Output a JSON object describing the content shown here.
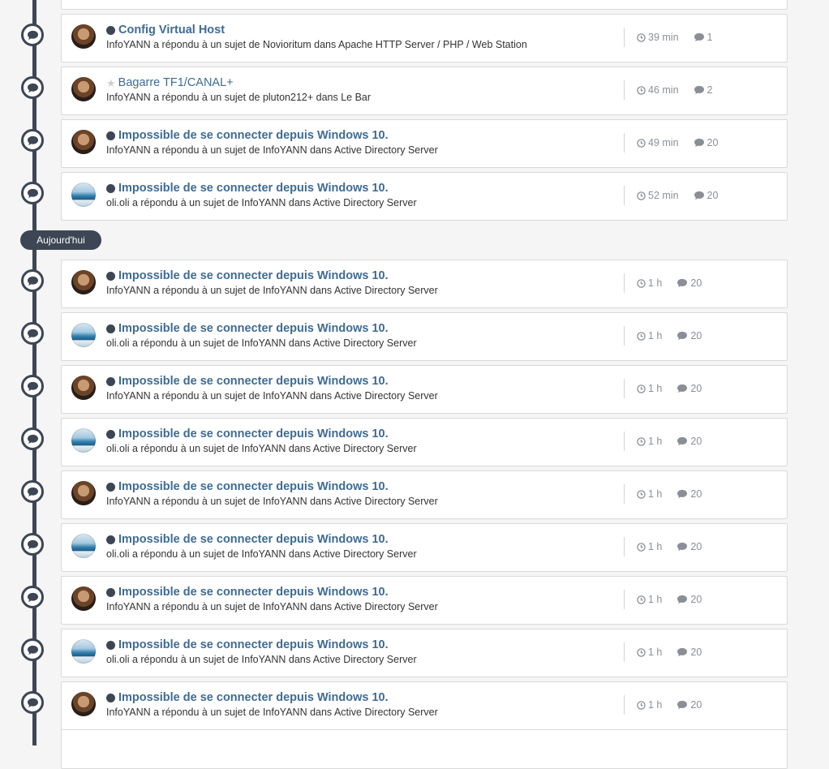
{
  "separator": {
    "label": "Aujourd'hui"
  },
  "items": [
    {
      "title": "Config Virtual Host",
      "regular": false,
      "unread": true,
      "avatar": "infoyann",
      "desc": "InfoYANN a répondu à un sujet de Novioritum dans Apache HTTP Server / PHP / Web Station",
      "time": "39 min",
      "replies": "1"
    },
    {
      "title": "Bagarre TF1/CANAL+",
      "regular": true,
      "unread": false,
      "avatar": "infoyann",
      "desc": "InfoYANN a répondu à un sujet de pluton212+ dans Le Bar",
      "time": "46 min",
      "replies": "2"
    },
    {
      "title": "Impossible de se connecter depuis Windows 10.",
      "regular": false,
      "unread": true,
      "avatar": "infoyann",
      "desc": "InfoYANN a répondu à un sujet de InfoYANN dans Active Directory Server",
      "time": "49 min",
      "replies": "20"
    },
    {
      "title": "Impossible de se connecter depuis Windows 10.",
      "regular": false,
      "unread": true,
      "avatar": "olioli",
      "desc": "oli.oli a répondu à un sujet de InfoYANN dans Active Directory Server",
      "time": "52 min",
      "replies": "20"
    },
    {
      "title": "Impossible de se connecter depuis Windows 10.",
      "regular": false,
      "unread": true,
      "avatar": "infoyann",
      "desc": "InfoYANN a répondu à un sujet de InfoYANN dans Active Directory Server",
      "time": "1 h",
      "replies": "20"
    },
    {
      "title": "Impossible de se connecter depuis Windows 10.",
      "regular": false,
      "unread": true,
      "avatar": "olioli",
      "desc": "oli.oli a répondu à un sujet de InfoYANN dans Active Directory Server",
      "time": "1 h",
      "replies": "20"
    },
    {
      "title": "Impossible de se connecter depuis Windows 10.",
      "regular": false,
      "unread": true,
      "avatar": "infoyann",
      "desc": "InfoYANN a répondu à un sujet de InfoYANN dans Active Directory Server",
      "time": "1 h",
      "replies": "20"
    },
    {
      "title": "Impossible de se connecter depuis Windows 10.",
      "regular": false,
      "unread": true,
      "avatar": "olioli",
      "desc": "oli.oli a répondu à un sujet de InfoYANN dans Active Directory Server",
      "time": "1 h",
      "replies": "20"
    },
    {
      "title": "Impossible de se connecter depuis Windows 10.",
      "regular": false,
      "unread": true,
      "avatar": "infoyann",
      "desc": "InfoYANN a répondu à un sujet de InfoYANN dans Active Directory Server",
      "time": "1 h",
      "replies": "20"
    },
    {
      "title": "Impossible de se connecter depuis Windows 10.",
      "regular": false,
      "unread": true,
      "avatar": "olioli",
      "desc": "oli.oli a répondu à un sujet de InfoYANN dans Active Directory Server",
      "time": "1 h",
      "replies": "20"
    },
    {
      "title": "Impossible de se connecter depuis Windows 10.",
      "regular": false,
      "unread": true,
      "avatar": "infoyann",
      "desc": "InfoYANN a répondu à un sujet de InfoYANN dans Active Directory Server",
      "time": "1 h",
      "replies": "20"
    },
    {
      "title": "Impossible de se connecter depuis Windows 10.",
      "regular": false,
      "unread": true,
      "avatar": "olioli",
      "desc": "oli.oli a répondu à un sujet de InfoYANN dans Active Directory Server",
      "time": "1 h",
      "replies": "20"
    },
    {
      "title": "Impossible de se connecter depuis Windows 10.",
      "regular": false,
      "unread": true,
      "avatar": "infoyann",
      "desc": "InfoYANN a répondu à un sujet de InfoYANN dans Active Directory Server",
      "time": "1 h",
      "replies": "20"
    }
  ]
}
